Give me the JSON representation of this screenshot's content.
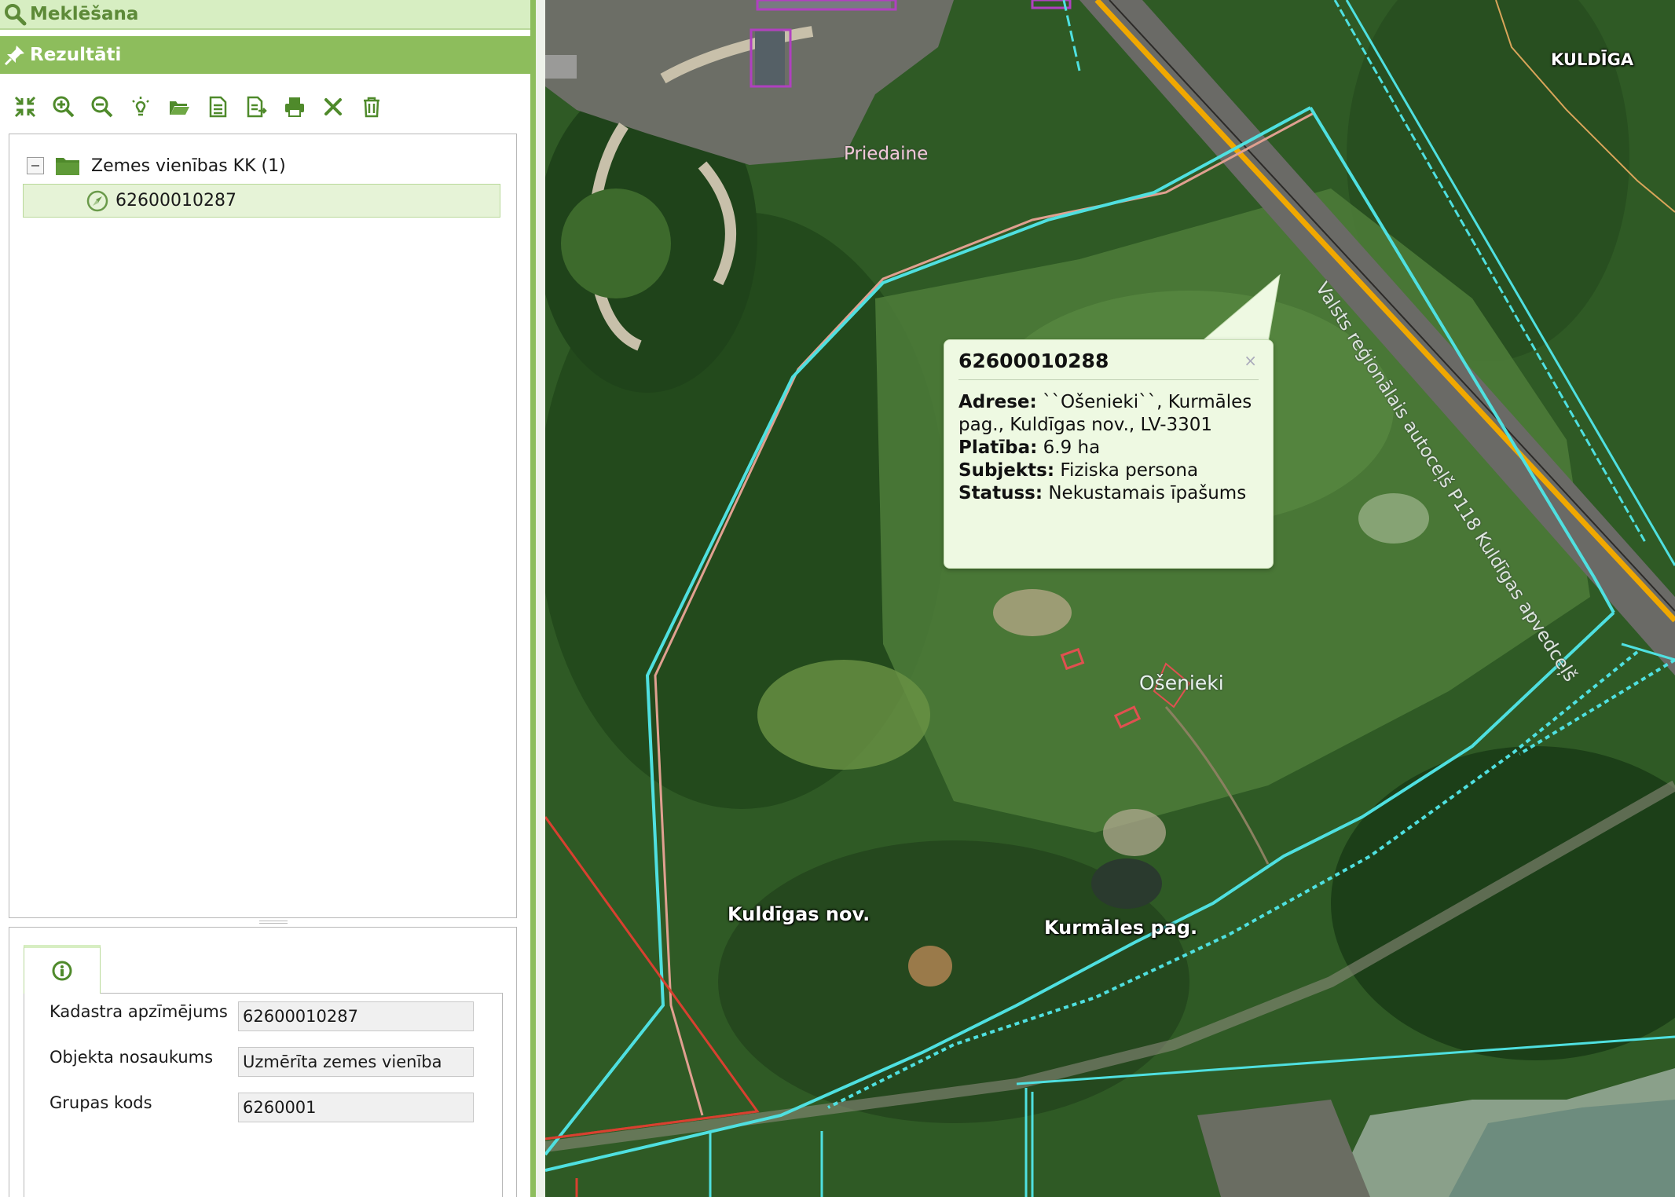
{
  "accordion": {
    "search_label": "Meklēšana",
    "results_label": "Rezultāti"
  },
  "toolbar": {
    "buttons": [
      "zoom-to-all",
      "zoom-in",
      "zoom-out",
      "highlight",
      "open",
      "document",
      "export-document",
      "print",
      "clear",
      "delete"
    ]
  },
  "tree": {
    "group_label": "Zemes vienības KK (1)",
    "item_label": "62600010287"
  },
  "details": {
    "rows": [
      {
        "label": "Kadastra apzīmējums",
        "value": "62600010287"
      },
      {
        "label": "Objekta nosaukums",
        "value": "Uzmērīta zemes vienība"
      },
      {
        "label": "Grupas kods",
        "value": "6260001"
      }
    ]
  },
  "map": {
    "labels": {
      "priedaine": "Priedaine",
      "kuldiga": "KULDĪGA",
      "road": "Valsts reģionālais autoceļš P118 Kuldīgas apvedceļš",
      "osenieki": "Ošenieki",
      "kuldigas_nov": "Kuldīgas nov.",
      "kurmales_pag": "Kurmāles pag."
    },
    "popup": {
      "title": "62600010288",
      "close": "×",
      "address_label": "Adrese:",
      "address_value": "``Ošenieki``, Kurmāles pag., Kuldīgas nov., LV-3301",
      "area_label": "Platība:",
      "area_value": "6.9 ha",
      "subject_label": "Subjekts:",
      "subject_value": "Fiziska persona",
      "status_label": "Statuss:",
      "status_value": "Nekustamais īpašums"
    },
    "colors": {
      "parcel_boundary": "#4fe0e0",
      "old_boundary": "#e0a090",
      "admin_boundary": "#d84030",
      "road": "#f0a800",
      "building": "#b040c0"
    }
  }
}
